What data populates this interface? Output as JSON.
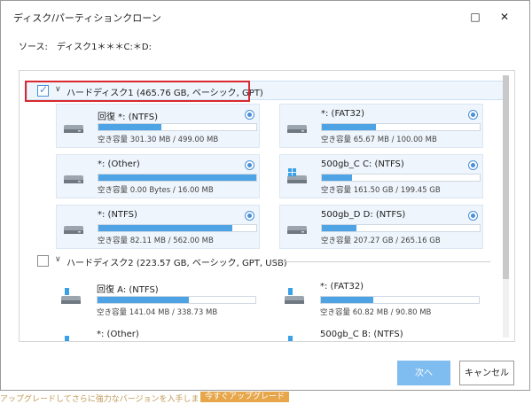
{
  "window": {
    "title": "ディスク/パーティションクローン",
    "minimize": "□",
    "close": "✕"
  },
  "source": {
    "text": "ソース:　ディスク1＊＊＊C:＊D:"
  },
  "disk1": {
    "label": "ハードディスク1 (465.76 GB, ベーシック, GPT)",
    "checked": true,
    "partitions": [
      {
        "name": "回復 *: (NTFS)",
        "free": "空き容量 301.30 MB / 499.00 MB",
        "used_fraction": 0.4
      },
      {
        "name": "*: (FAT32)",
        "free": "空き容量 65.67 MB / 100.00 MB",
        "used_fraction": 0.34
      },
      {
        "name": "*: (Other)",
        "free": "空き容量 0.00 Bytes / 16.00 MB",
        "used_fraction": 1.0
      },
      {
        "name": "500gb_C C: (NTFS)",
        "free": "空き容量 161.50 GB / 199.45 GB",
        "used_fraction": 0.19
      },
      {
        "name": "*: (NTFS)",
        "free": "空き容量 82.11 MB / 562.00 MB",
        "used_fraction": 0.85
      },
      {
        "name": "500gb_D D: (NTFS)",
        "free": "空き容量 207.27 GB / 265.16 GB",
        "used_fraction": 0.22
      }
    ]
  },
  "disk2": {
    "label": "ハードディスク2 (223.57 GB, ベーシック, GPT, USB)",
    "checked": false,
    "partitions": [
      {
        "name": "回復 A: (NTFS)",
        "free": "空き容量 141.04 MB / 338.73 MB",
        "used_fraction": 0.58
      },
      {
        "name": "*: (FAT32)",
        "free": "空き容量 60.82 MB / 90.80 MB",
        "used_fraction": 0.33
      },
      {
        "name": "*: (Other)"
      },
      {
        "name": "500gb_C B: (NTFS)"
      }
    ]
  },
  "buttons": {
    "next": "次へ",
    "cancel": "キャンセル"
  },
  "footer": {
    "text": "アップグレードしてさらに強力なバージョンを入手しましょう。",
    "link": "今すぐアップグレード"
  },
  "colors": {
    "accent": "#4ea3e5",
    "highlight_border": "#d9282f",
    "card_bg": "#eef5fc",
    "next_button": "#7fbcf0"
  }
}
